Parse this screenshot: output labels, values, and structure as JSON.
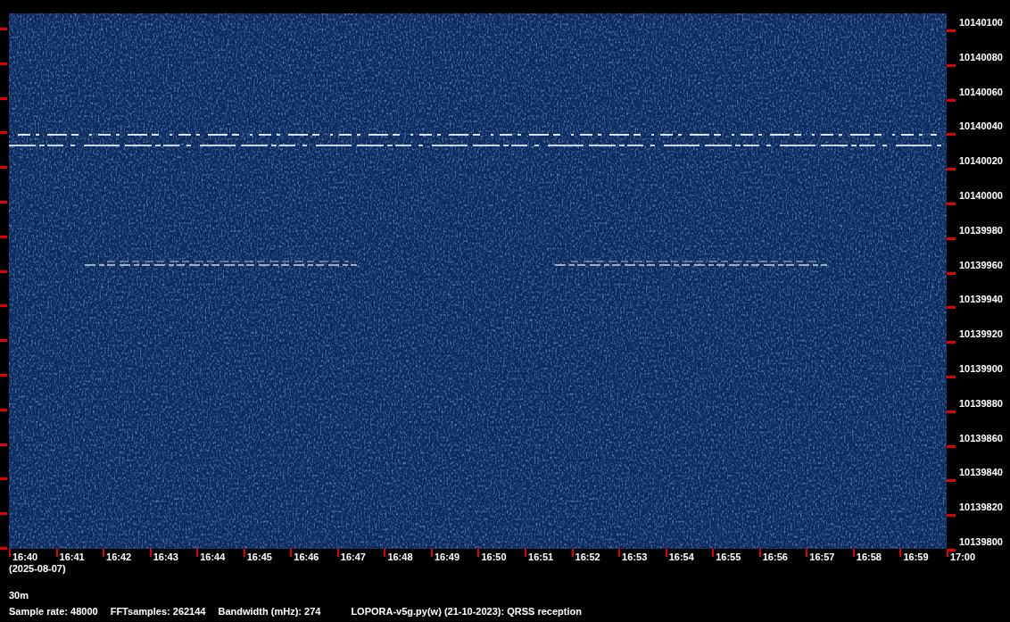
{
  "frequency_axis": {
    "labels": [
      "10140100",
      "10140080",
      "10140060",
      "10140040",
      "10140020",
      "10140000",
      "10139980",
      "10139960",
      "10139940",
      "10139920",
      "10139900",
      "10139880",
      "10139860",
      "10139840",
      "10139820",
      "10139800"
    ]
  },
  "time_axis": {
    "labels": [
      "16:40",
      "16:41",
      "16:42",
      "16:43",
      "16:44",
      "16:45",
      "16:46",
      "16:47",
      "16:48",
      "16:49",
      "16:50",
      "16:51",
      "16:52",
      "16:53",
      "16:54",
      "16:55",
      "16:56",
      "16:57",
      "16:58",
      "16:59",
      "17:00"
    ],
    "date": "(2025-08-07)"
  },
  "band": "30m",
  "status_bar": {
    "items": [
      "Sample rate: 48000",
      "FFTsamples: 262144",
      "Bandwidth (mHz): 274",
      "LOPORA-v5g.py(w) (21-10-2023): QRSS reception"
    ]
  }
}
